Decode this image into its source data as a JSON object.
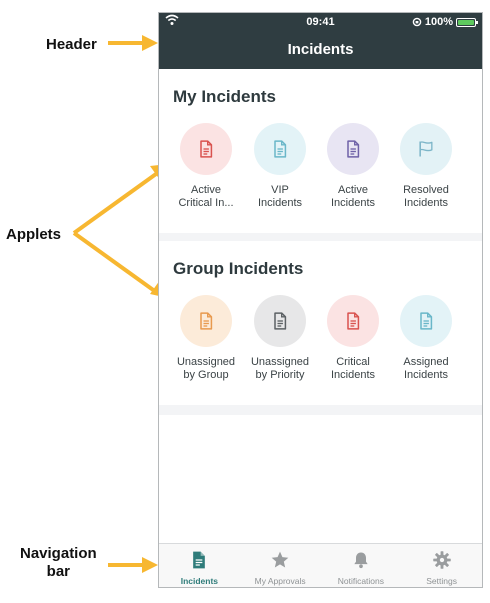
{
  "annotations": {
    "header": "Header",
    "applets": "Applets",
    "navigation_line1": "Navigation",
    "navigation_line2": "bar"
  },
  "status_bar": {
    "time": "09:41",
    "battery": "100%"
  },
  "header": {
    "title": "Incidents"
  },
  "sections": [
    {
      "title": "My Incidents",
      "applets": [
        {
          "line1": "Active",
          "line2": "Critical In...",
          "icon": "document-icon",
          "color": "#d9534f",
          "bg": "#fbe3e3"
        },
        {
          "line1": "VIP",
          "line2": "Incidents",
          "icon": "document-icon",
          "color": "#6ab7c9",
          "bg": "#e3f3f7"
        },
        {
          "line1": "Active",
          "line2": "Incidents",
          "icon": "document-icon",
          "color": "#6f62a8",
          "bg": "#e8e5f3"
        },
        {
          "line1": "Resolved",
          "line2": "Incidents",
          "icon": "flag-icon",
          "color": "#7cb5c8",
          "bg": "#e3f2f6"
        }
      ]
    },
    {
      "title": "Group Incidents",
      "applets": [
        {
          "line1": "Unassigned",
          "line2": "by Group",
          "icon": "document-icon",
          "color": "#e89a4f",
          "bg": "#fcebd9"
        },
        {
          "line1": "Unassigned",
          "line2": "by Priority",
          "icon": "document-icon",
          "color": "#5c6164",
          "bg": "#e7e7e8"
        },
        {
          "line1": "Critical",
          "line2": "Incidents",
          "icon": "document-icon",
          "color": "#d9534f",
          "bg": "#fbe3e3"
        },
        {
          "line1": "Assigned",
          "line2": "Incidents",
          "icon": "document-icon",
          "color": "#6ab7c9",
          "bg": "#e3f3f7"
        }
      ]
    }
  ],
  "nav": {
    "items": [
      {
        "label": "Incidents",
        "icon": "document-icon",
        "active": true
      },
      {
        "label": "My Approvals",
        "icon": "star-icon",
        "active": false
      },
      {
        "label": "Notifications",
        "icon": "bell-icon",
        "active": false
      },
      {
        "label": "Settings",
        "icon": "gear-icon",
        "active": false
      }
    ],
    "active_color": "#2f7c7a",
    "inactive_color": "#9a9d9f"
  }
}
